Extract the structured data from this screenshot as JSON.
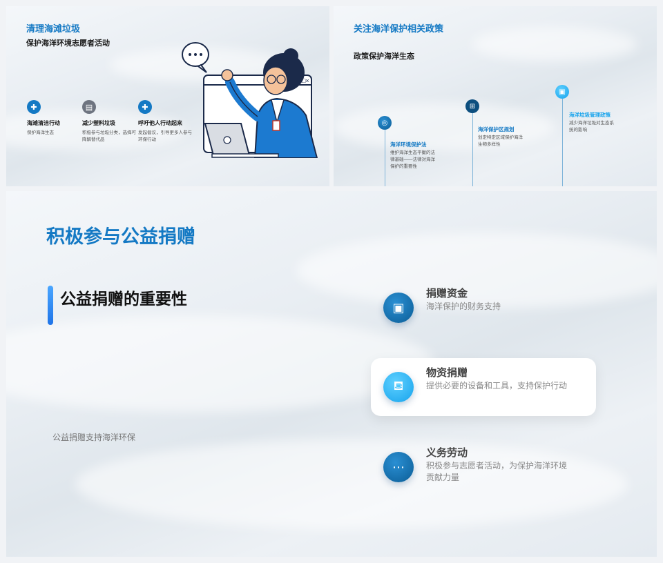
{
  "slide1": {
    "title": "清理海滩垃圾",
    "subtitle": "保护海洋环境志愿者活动",
    "features": [
      {
        "icon": "puzzle-icon",
        "title": "海滩清洁行动",
        "desc": "保护海洋生态"
      },
      {
        "icon": "clipboard-icon",
        "title": "减少塑料垃圾",
        "desc": "积极参与垃圾分类，选择可降解替代品"
      },
      {
        "icon": "puzzle-icon",
        "title": "呼吁他人行动起来",
        "desc": "发起倡议，引导更多人参与环保行动"
      }
    ],
    "bubble_text": "..."
  },
  "slide2": {
    "title": "关注海洋保护相关政策",
    "subtitle": "政策保护海洋生态",
    "timeline": [
      {
        "icon": "target-icon",
        "title": "海洋环境保护法",
        "desc": "维护海洋生态平衡的法律基础——法律对海洋保护的重要性"
      },
      {
        "icon": "hierarchy-icon",
        "title": "海洋保护区规划",
        "desc": "划定特定区域保护海洋生物多样性"
      },
      {
        "icon": "image-icon",
        "title": "海洋垃圾管理政策",
        "desc": "减少海洋垃圾对生态系统的影响"
      }
    ]
  },
  "slide3": {
    "title": "积极参与公益捐赠",
    "heading": "公益捐赠的重要性",
    "footer": "公益捐赠支持海洋环保",
    "items": [
      {
        "icon": "image-icon",
        "title": "捐赠资金",
        "desc": "海洋保护的财务支持"
      },
      {
        "icon": "sofa-icon",
        "title": "物资捐赠",
        "desc": "提供必要的设备和工具，支持保护行动"
      },
      {
        "icon": "chat-icon",
        "title": "义务劳动",
        "desc": "积极参与志愿者活动，为保护海洋环境贡献力量"
      }
    ]
  },
  "colors": {
    "accent": "#1479c4",
    "light_accent": "#16a3ec"
  }
}
